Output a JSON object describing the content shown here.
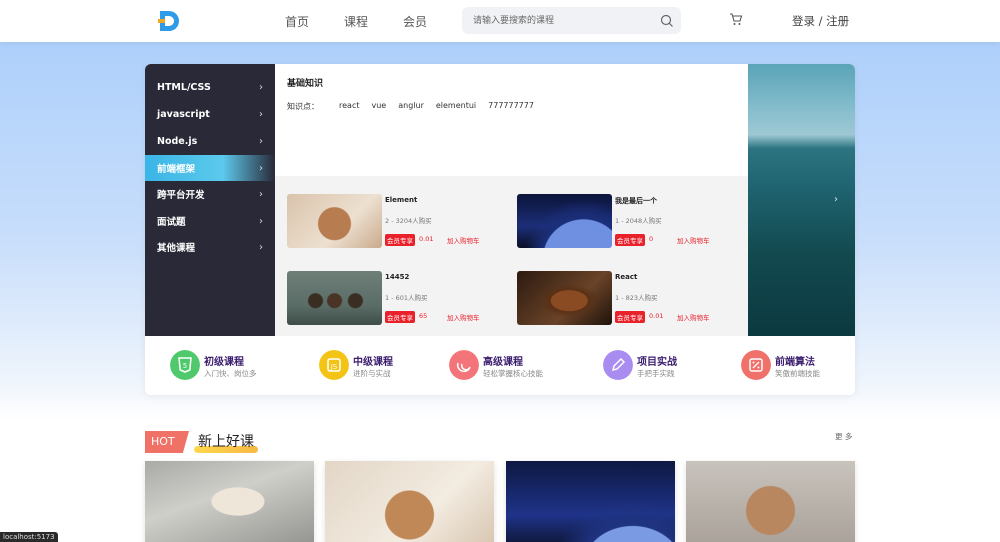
{
  "header": {
    "nav": [
      "首页",
      "课程",
      "会员"
    ],
    "search_placeholder": "请输入要搜索的课程",
    "login": "登录 / 注册"
  },
  "sidebar": {
    "items": [
      {
        "label": "HTML/CSS"
      },
      {
        "label": "javascript"
      },
      {
        "label": "Node.js"
      },
      {
        "label": "前端框架",
        "active": true
      },
      {
        "label": "跨平台开发"
      },
      {
        "label": "面试题"
      },
      {
        "label": "其他课程"
      }
    ]
  },
  "panel": {
    "title": "基础知识",
    "kp_label": "知识点：",
    "keywords": [
      "react",
      "vue",
      "anglur",
      "elementui",
      "777777777"
    ],
    "courses": [
      {
        "name": "Element",
        "buyers": "2 - 3204人购买",
        "vip": "会员专享",
        "price": "0.01",
        "cart": "加入购物车"
      },
      {
        "name": "我是最后一个",
        "buyers": "1 - 2048人购买",
        "vip": "会员专享",
        "price": "0",
        "cart": "加入购物车"
      },
      {
        "name": "14452",
        "buyers": "1 - 601人购买",
        "vip": "会员专享",
        "price": "65",
        "cart": "加入购物车"
      },
      {
        "name": "React",
        "buyers": "1 - 823人购买",
        "vip": "会员专享",
        "price": "0.01",
        "cart": "加入购物车"
      }
    ]
  },
  "categories": [
    {
      "title": "初级课程",
      "sub": "入门快、岗位多",
      "color": "#4fc96c"
    },
    {
      "title": "中级课程",
      "sub": "进阶与实战",
      "color": "#f3c316"
    },
    {
      "title": "高级课程",
      "sub": "轻松掌握核心技能",
      "color": "#f3757a"
    },
    {
      "title": "项目实战",
      "sub": "手把手实践",
      "color": "#a98cf0"
    },
    {
      "title": "前端算法",
      "sub": "笑傲前端技能",
      "color": "#f0706a"
    }
  ],
  "new_section": {
    "badge": "HOT",
    "title": "新上好课",
    "more": "更 多"
  },
  "status_bar": "localhost:5173",
  "colors": {
    "sidebar_bg": "#292938",
    "active_item": "#3ab5e6",
    "price_red": "#e8212b",
    "hot_badge": "#f07165"
  }
}
